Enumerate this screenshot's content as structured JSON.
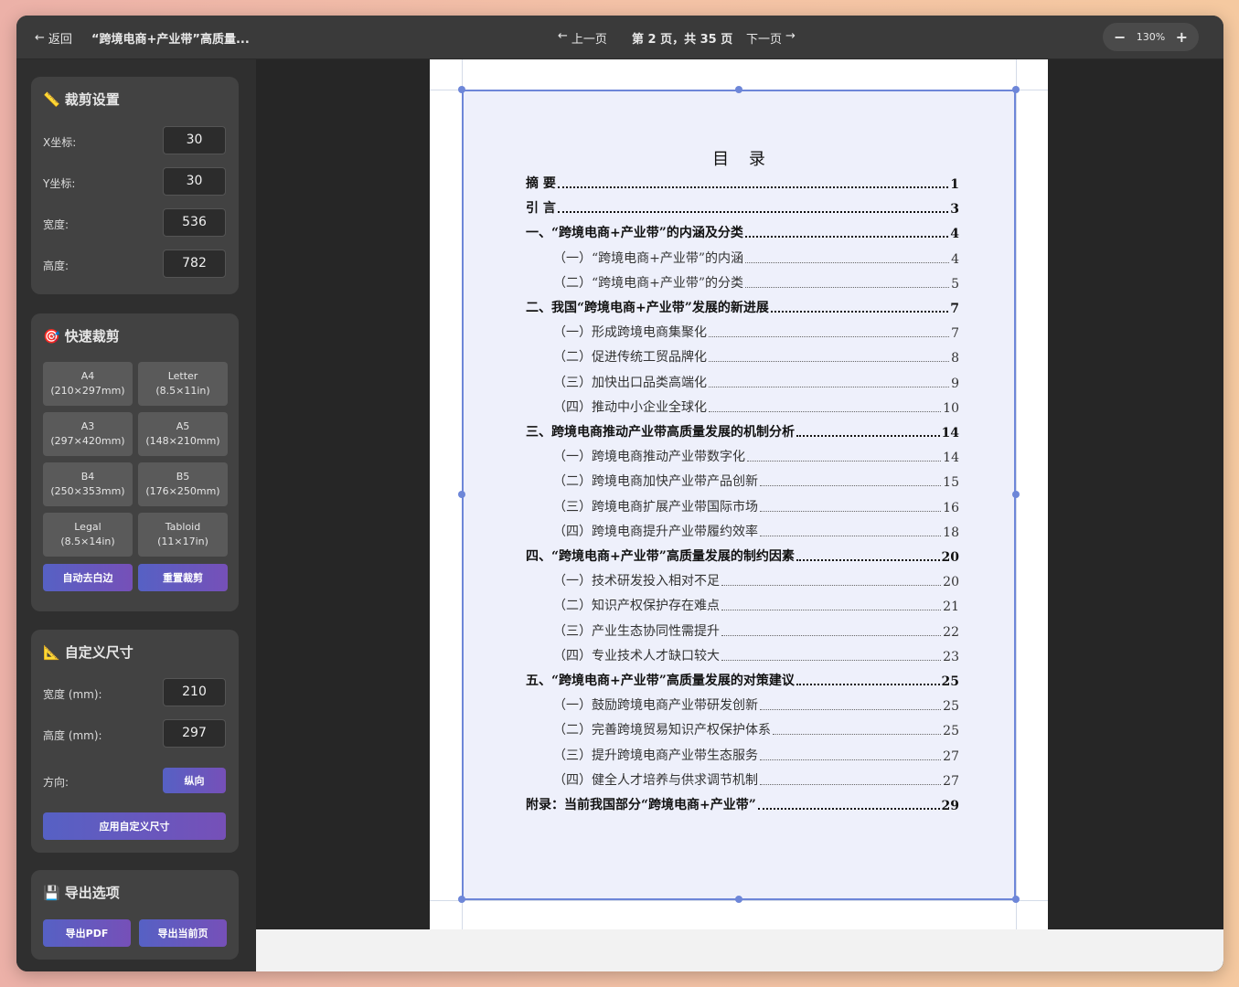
{
  "toolbar": {
    "back_label": "返回",
    "doc_title": "“跨境电商+产业带”高质量...",
    "prev_label": "上一页",
    "page_indicator": "第 2 页，共 35 页",
    "next_label": "下一页",
    "zoom_minus": "−",
    "zoom_level": "130%",
    "zoom_plus": "+"
  },
  "crop_settings": {
    "title": "裁剪设置",
    "fields": [
      {
        "label": "X坐标:",
        "value": "30"
      },
      {
        "label": "Y坐标:",
        "value": "30"
      },
      {
        "label": "宽度:",
        "value": "536"
      },
      {
        "label": "高度:",
        "value": "782"
      }
    ]
  },
  "quick_crop": {
    "title": "快速裁剪",
    "sizes": [
      {
        "name": "A4",
        "dims": "(210×297mm)"
      },
      {
        "name": "Letter",
        "dims": "(8.5×11in)"
      },
      {
        "name": "A3",
        "dims": "(297×420mm)"
      },
      {
        "name": "A5",
        "dims": "(148×210mm)"
      },
      {
        "name": "B4",
        "dims": "(250×353mm)"
      },
      {
        "name": "B5",
        "dims": "(176×250mm)"
      },
      {
        "name": "Legal",
        "dims": "(8.5×14in)"
      },
      {
        "name": "Tabloid",
        "dims": "(11×17in)"
      }
    ],
    "auto_trim_label": "自动去白边",
    "reset_label": "重置裁剪"
  },
  "custom_size": {
    "title": "自定义尺寸",
    "width_label": "宽度 (mm):",
    "width_value": "210",
    "height_label": "高度 (mm):",
    "height_value": "297",
    "orientation_label": "方向:",
    "orientation_value": "纵向",
    "apply_label": "应用自定义尺寸"
  },
  "export": {
    "title": "导出选项",
    "pdf_label": "导出PDF",
    "current_label": "导出当前页"
  },
  "toc": {
    "title": "目 录",
    "entries": [
      {
        "level": 1,
        "label": "摘  要",
        "page": "1"
      },
      {
        "level": 1,
        "label": "引  言",
        "page": "3"
      },
      {
        "level": 1,
        "label": "一、“跨境电商+产业带”的内涵及分类",
        "page": "4"
      },
      {
        "level": 2,
        "label": "（一）“跨境电商+产业带”的内涵",
        "page": "4"
      },
      {
        "level": 2,
        "label": "（二）“跨境电商+产业带”的分类",
        "page": "5"
      },
      {
        "level": 1,
        "label": "二、我国“跨境电商+产业带”发展的新进展",
        "page": "7"
      },
      {
        "level": 2,
        "label": "（一）形成跨境电商集聚化",
        "page": "7"
      },
      {
        "level": 2,
        "label": "（二）促进传统工贸品牌化",
        "page": "8"
      },
      {
        "level": 2,
        "label": "（三）加快出口品类高端化",
        "page": "9"
      },
      {
        "level": 2,
        "label": "（四）推动中小企业全球化",
        "page": "10"
      },
      {
        "level": 1,
        "label": "三、跨境电商推动产业带高质量发展的机制分析",
        "page": "14"
      },
      {
        "level": 2,
        "label": "（一）跨境电商推动产业带数字化",
        "page": "14"
      },
      {
        "level": 2,
        "label": "（二）跨境电商加快产业带产品创新",
        "page": "15"
      },
      {
        "level": 2,
        "label": "（三）跨境电商扩展产业带国际市场",
        "page": "16"
      },
      {
        "level": 2,
        "label": "（四）跨境电商提升产业带履约效率",
        "page": "18"
      },
      {
        "level": 1,
        "label": "四、“跨境电商+产业带”高质量发展的制约因素",
        "page": "20"
      },
      {
        "level": 2,
        "label": "（一）技术研发投入相对不足",
        "page": "20"
      },
      {
        "level": 2,
        "label": "（二）知识产权保护存在难点",
        "page": "21"
      },
      {
        "level": 2,
        "label": "（三）产业生态协同性需提升",
        "page": "22"
      },
      {
        "level": 2,
        "label": "（四）专业技术人才缺口较大",
        "page": "23"
      },
      {
        "level": 1,
        "label": "五、“跨境电商+产业带”高质量发展的对策建议",
        "page": "25"
      },
      {
        "level": 2,
        "label": "（一）鼓励跨境电商产业带研发创新",
        "page": "25"
      },
      {
        "level": 2,
        "label": "（二）完善跨境贸易知识产权保护体系",
        "page": "25"
      },
      {
        "level": 2,
        "label": "（三）提升跨境电商产业带生态服务",
        "page": "27"
      },
      {
        "level": 2,
        "label": "（四）健全人才培养与供求调节机制",
        "page": "27"
      },
      {
        "level": 1,
        "label": "附录：当前我国部分“跨境电商+产业带”",
        "page": "29"
      }
    ]
  }
}
